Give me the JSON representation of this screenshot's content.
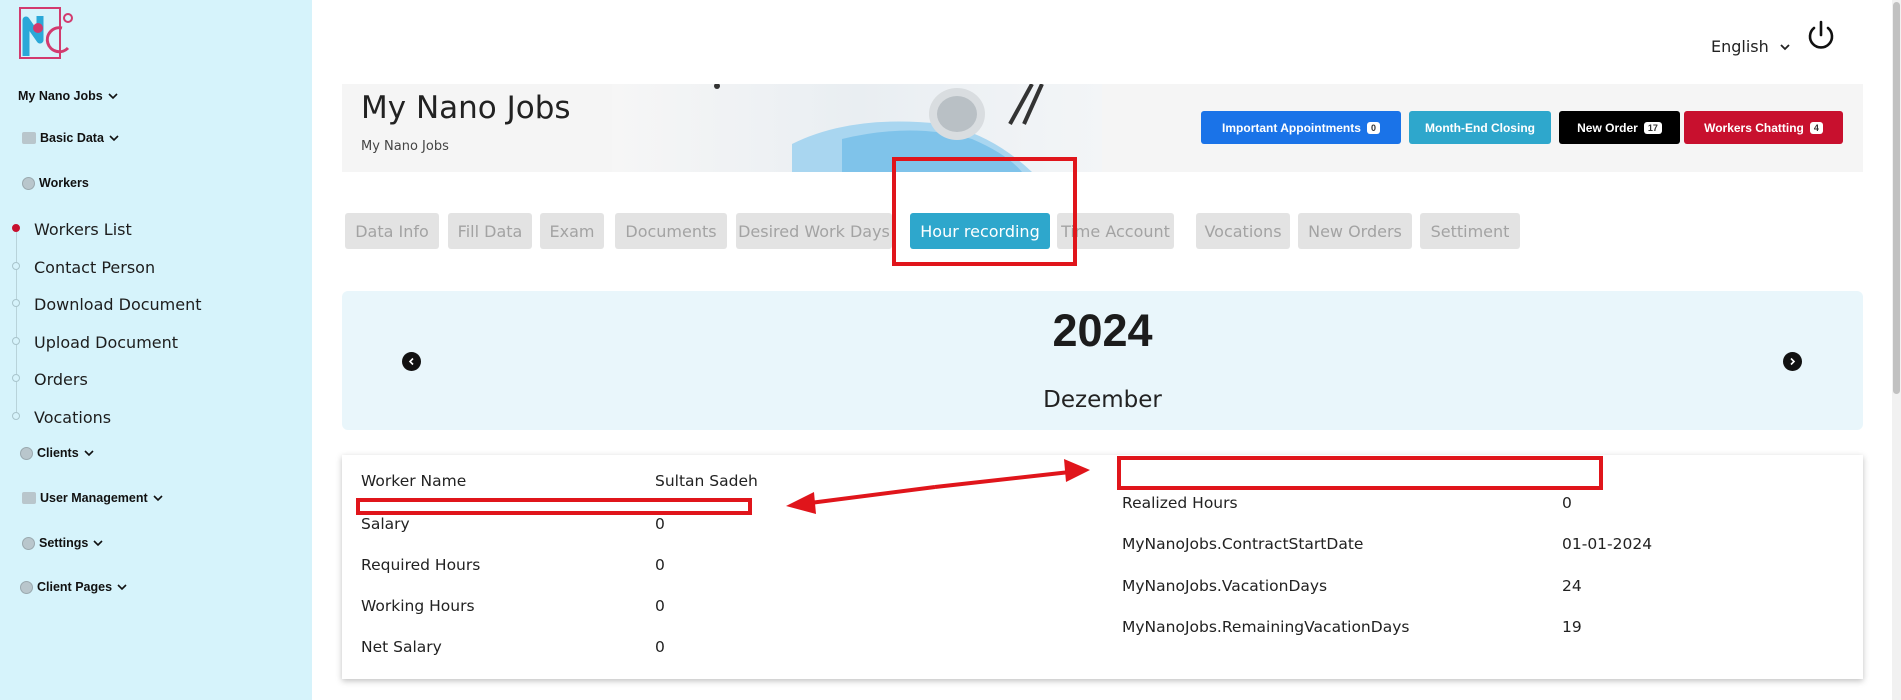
{
  "sidebar": {
    "groups": {
      "my_nano_jobs": "My Nano Jobs",
      "basic_data": "Basic Data",
      "workers": "Workers",
      "clients": "Clients",
      "user_management": "User Management",
      "settings": "Settings",
      "client_pages": "Client Pages"
    },
    "worker_items": [
      "Workers List",
      "Contact Person",
      "Download Document",
      "Upload Document",
      "Orders",
      "Vocations"
    ],
    "active_item": "Workers List"
  },
  "topbar": {
    "language": "English",
    "power_icon": "power-icon"
  },
  "banner": {
    "title": "My Nano Jobs",
    "subtitle": "My Nano Jobs"
  },
  "quick_buttons": [
    {
      "label": "Important Appointments",
      "badge": "0",
      "color": "#1a73e8"
    },
    {
      "label": "Month-End Closing",
      "badge": "",
      "color": "#2ea7cc"
    },
    {
      "label": "New Order",
      "badge": "17",
      "color": "#000000"
    },
    {
      "label": "Workers Chatting",
      "badge": "4",
      "color": "#c8102e"
    }
  ],
  "tabs": [
    "Data Info",
    "Fill Data",
    "Exam",
    "Documents",
    "Desired Work Days",
    "Hour recording",
    "Time Account",
    "Vocations",
    "New Orders",
    "Settiment"
  ],
  "active_tab": "Hour recording",
  "calendar": {
    "year": "2024",
    "month": "Dezember"
  },
  "info": {
    "left": [
      {
        "label": "Worker Name",
        "value": "Sultan Sadeh"
      },
      {
        "label": "Salary",
        "value": "0"
      },
      {
        "label": "Required Hours",
        "value": "0"
      },
      {
        "label": "Working Hours",
        "value": "0"
      },
      {
        "label": "Net Salary",
        "value": "0"
      }
    ],
    "right": [
      {
        "label": "Realized Hours",
        "value": "0"
      },
      {
        "label": "MyNanoJobs.ContractStartDate",
        "value": "01-01-2024"
      },
      {
        "label": "MyNanoJobs.VacationDays",
        "value": "24"
      },
      {
        "label": "MyNanoJobs.RemainingVacationDays",
        "value": "19"
      }
    ]
  },
  "colors": {
    "sidebar_bg": "#d6f3fb",
    "accent": "#2ea7cc",
    "annotation": "#e0151b"
  }
}
